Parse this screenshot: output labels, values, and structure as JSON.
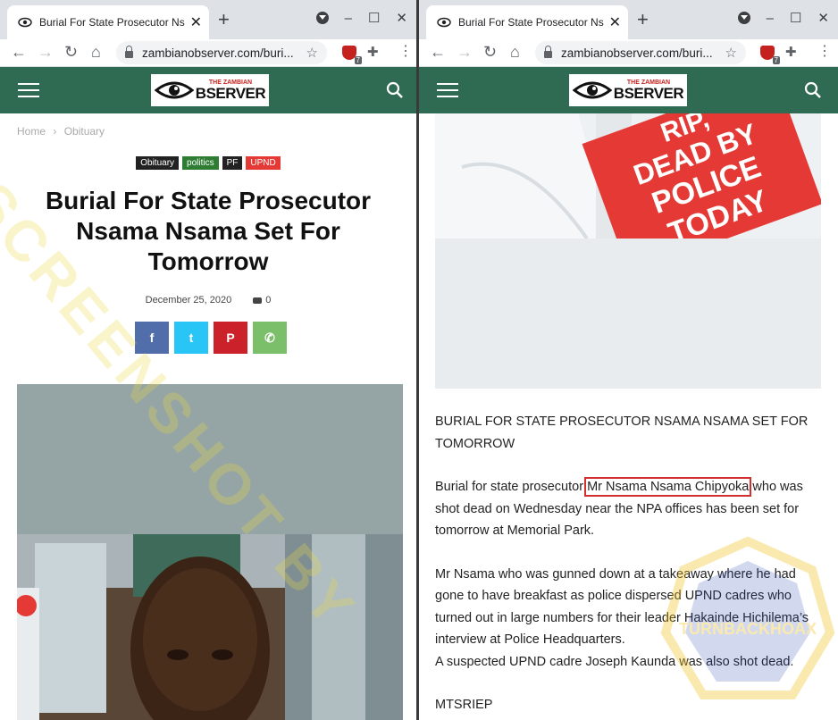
{
  "left": {
    "tab_title": "Burial For State Prosecutor Nsan",
    "url": "zambianobserver.com/buri...",
    "ext_badge": "7",
    "logo_small": "THE ZAMBIAN",
    "logo_big": "BSERVER",
    "breadcrumb": [
      "Home",
      "›",
      "Obituary"
    ],
    "tags": [
      {
        "label": "Obituary",
        "color": "#222222"
      },
      {
        "label": "politics",
        "color": "#2e7d32"
      },
      {
        "label": "PF",
        "color": "#222222"
      },
      {
        "label": "UPND",
        "color": "#e53935"
      }
    ],
    "headline": "Burial For State Prosecutor Nsama Nsama Set For Tomorrow",
    "date": "December 25, 2020",
    "comments": "0",
    "share_icons": [
      "facebook-icon",
      "twitter-icon",
      "pinterest-icon",
      "whatsapp-icon"
    ],
    "share_glyphs": [
      "f",
      "t",
      "P",
      "✆"
    ],
    "share_colors": [
      "#516eab",
      "#29c5f6",
      "#ca212a",
      "#7bbf6a"
    ]
  },
  "right": {
    "tab_title": "Burial For State Prosecutor Nsan",
    "url": "zambianobserver.com/buri...",
    "ext_badge": "7",
    "logo_small": "THE ZAMBIAN",
    "logo_big": "BSERVER",
    "sign_lines": [
      "RIP,",
      "DEAD BY",
      "POLICE",
      "TODAY"
    ],
    "title_para": "BURIAL FOR STATE PROSECUTOR NSAMA NSAMA SET FOR TOMORROW",
    "para1_before": "Burial for state prosecutor ",
    "para1_highlight": "Mr Nsama Nsama Chipyoka",
    "para1_after": " who was shot dead on Wednesday near the NPA offices has been set for tomorrow at Memorial Park.",
    "para2": "Mr Nsama who was gunned down at a takeaway where he had gone to have breakfast as police dispersed UPND cadres who turned out in large numbers for their leader Hakainde Hichilema’s interview at Police Headquarters.",
    "para3": "A suspected UPND cadre Joseph Kaunda was also shot dead.",
    "para4": "MTSRIEP"
  },
  "watermark": "SCREENSHOT BY",
  "stamp_text": "TURNBACKHOAX",
  "colors": {
    "site_green": "#2f6b52",
    "highlight_red": "#d32f2f"
  }
}
